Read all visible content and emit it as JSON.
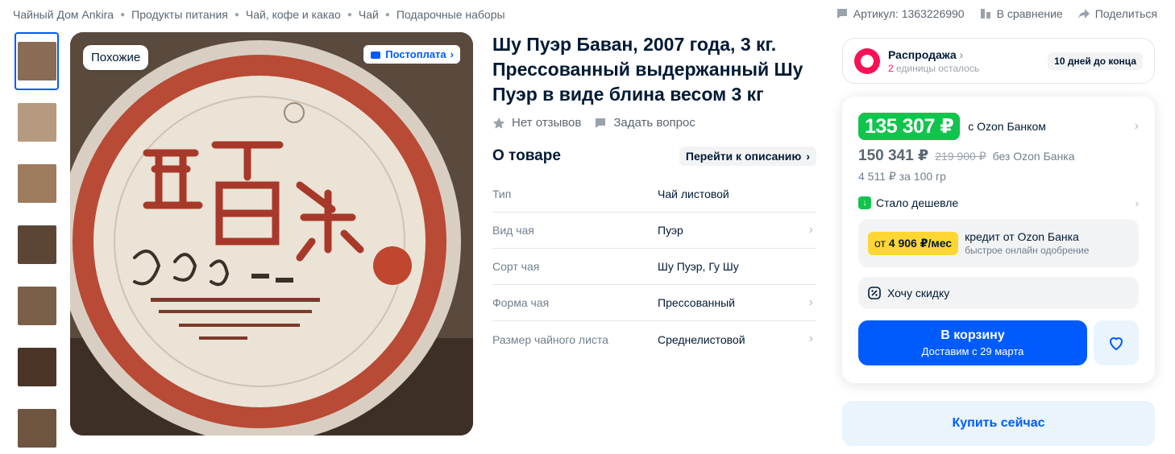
{
  "breadcrumbs": [
    "Чайный Дом Ankira",
    "Продукты питания",
    "Чай, кофе и какао",
    "Чай",
    "Подарочные наборы"
  ],
  "top_actions": {
    "article": "Артикул: 1363226990",
    "compare": "В сравнение",
    "share": "Поделиться"
  },
  "gallery": {
    "similar_label": "Похожие",
    "postpay_label": "Постоплата",
    "thumbs": [
      {
        "color": "#8a6b55"
      },
      {
        "color": "#b59a80"
      },
      {
        "color": "#9c7b5e"
      },
      {
        "color": "#5b4636"
      },
      {
        "color": "#7a6048"
      },
      {
        "color": "#4a3526"
      },
      {
        "color": "#6e5540"
      }
    ]
  },
  "product": {
    "title": "Шу Пуэр Баван, 2007 года, 3 кг. Прессованный выдержанный Шу Пуэр в виде блина весом 3 кг",
    "reviews": "Нет отзывов",
    "ask": "Задать вопрос"
  },
  "about": {
    "title": "О товаре",
    "goto": "Перейти к описанию",
    "specs": [
      {
        "name": "Тип",
        "value": "Чай листовой",
        "link": false
      },
      {
        "name": "Вид чая",
        "value": "Пуэр",
        "link": true
      },
      {
        "name": "Сорт чая",
        "value": "Шу Пуэр, Гу Шу",
        "link": false
      },
      {
        "name": "Форма чая",
        "value": "Прессованный",
        "link": true
      },
      {
        "name": "Размер чайного листа",
        "value": "Среднелистовой",
        "link": true
      }
    ]
  },
  "sale": {
    "title": "Распродажа",
    "count": "2",
    "remaining": " единицы осталось",
    "days_left": "10 дней до конца"
  },
  "price": {
    "bank_price": "135 307 ₽",
    "bank_note": "с Ozon Банком",
    "price": "150 341 ₽",
    "old_price": "219 900 ₽",
    "price_note": "без Ozon Банка",
    "per_unit": "4 511 ₽ за 100 гр",
    "cheaper": "Стало дешевле",
    "credit_from": "от ",
    "credit_amount": "4 906 ₽/мес",
    "credit_title": "кредит от Ozon Банка",
    "credit_sub": "быстрое онлайн одобрение",
    "discount": "Хочу скидку",
    "cart_label": "В корзину",
    "cart_sub": "Доставим с 29 марта",
    "buy_now": "Купить сейчас"
  }
}
